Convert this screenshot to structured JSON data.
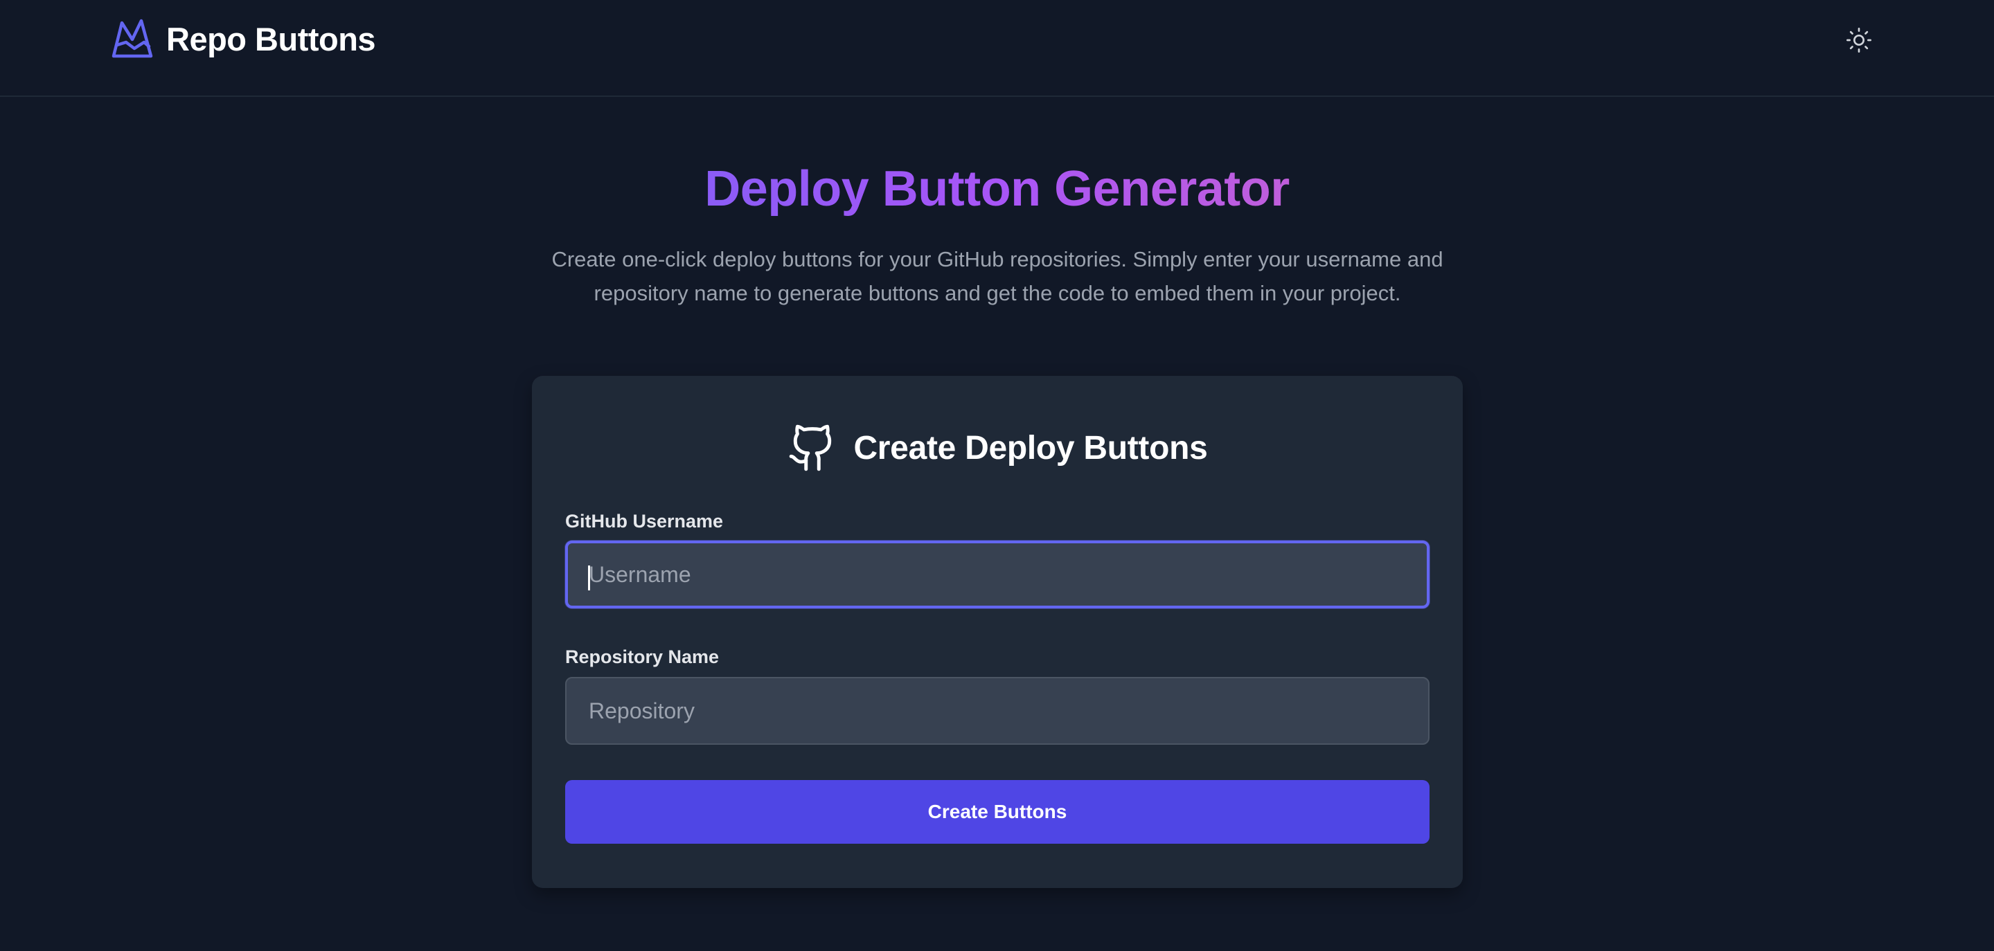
{
  "header": {
    "brand_name": "Repo Buttons",
    "brand_icon": "mountain-crown-logo-icon",
    "theme_toggle_icon": "sun-icon"
  },
  "hero": {
    "title": "Deploy Button Generator",
    "subtitle": "Create one-click deploy buttons for your GitHub repositories. Simply enter your username and repository name to generate buttons and get the code to embed them in your project."
  },
  "form": {
    "title": "Create Deploy Buttons",
    "title_icon": "github-icon",
    "username": {
      "label": "GitHub Username",
      "placeholder": "Username",
      "value": ""
    },
    "repository": {
      "label": "Repository Name",
      "placeholder": "Repository",
      "value": ""
    },
    "submit_label": "Create Buttons"
  },
  "colors": {
    "background": "#111827",
    "card": "#1f2937",
    "input": "#374151",
    "accent": "#4f46e5",
    "focus_ring": "#6366f1",
    "title_gradient_start": "#8b5cf6",
    "title_gradient_end": "#c05edb"
  }
}
